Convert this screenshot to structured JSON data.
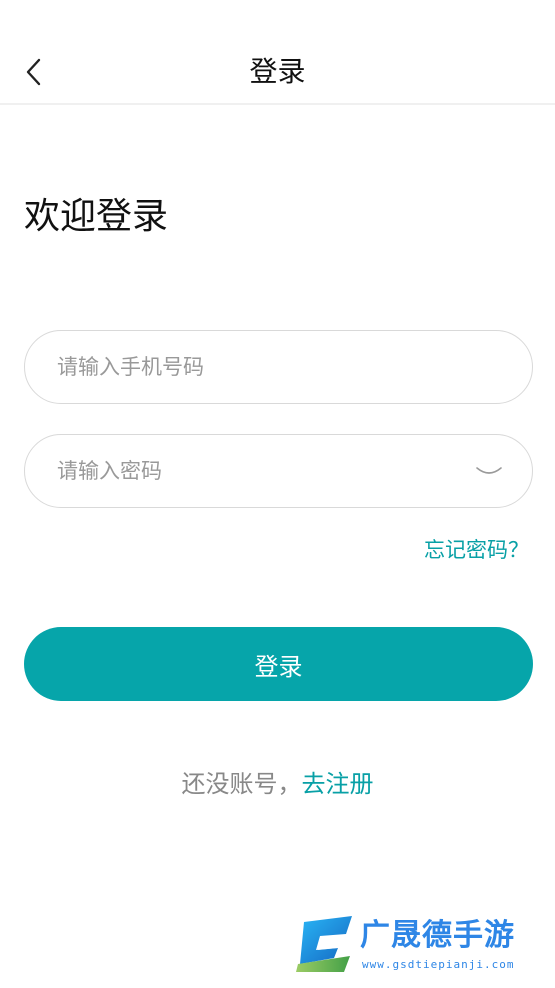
{
  "header": {
    "title": "登录"
  },
  "welcome_text": "欢迎登录",
  "form": {
    "phone": {
      "placeholder": "请输入手机号码",
      "value": ""
    },
    "password": {
      "placeholder": "请输入密码",
      "value": ""
    },
    "forgot_password": "忘记密码？",
    "login_label": "登录"
  },
  "register": {
    "prompt": "还没账号，",
    "link": "去注册"
  },
  "watermark": {
    "name": "广晟德手游",
    "url": "www.gsdtiepianji.com"
  },
  "colors": {
    "accent": "#06a5aa",
    "link": "#08a0a6",
    "placeholder": "#999999",
    "border": "#d9d9d9"
  },
  "icons": {
    "back": "chevron-left-icon",
    "password_toggle": "eye-closed-icon"
  }
}
